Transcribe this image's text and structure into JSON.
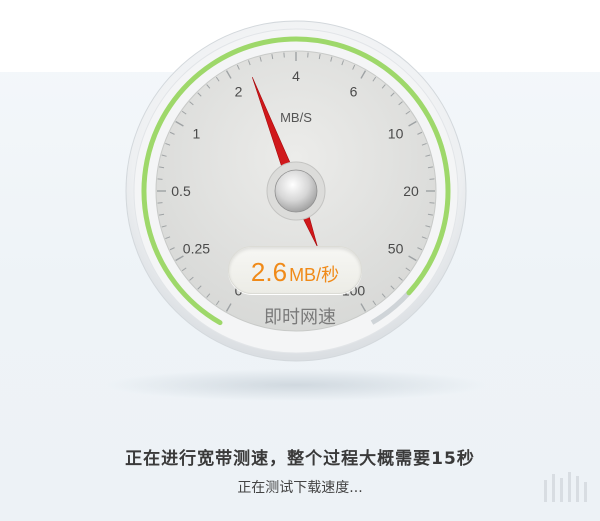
{
  "gauge": {
    "unit_label": "MB/S",
    "scale_labels": [
      "0",
      "0.25",
      "0.5",
      "1",
      "2",
      "4",
      "6",
      "10",
      "20",
      "50",
      "100"
    ],
    "current_speed": 2.6,
    "current_speed_text": "2.6",
    "readout_unit": "MB/秒",
    "readout_caption": "即时网速",
    "needle_color": "#d0181b",
    "arc_color": "#9ed86a",
    "readout_color": "#f08a18"
  },
  "status": {
    "main_text": "正在进行宽带测速，整个过程大概需要15秒",
    "sub_text": "正在测试下载速度..."
  }
}
